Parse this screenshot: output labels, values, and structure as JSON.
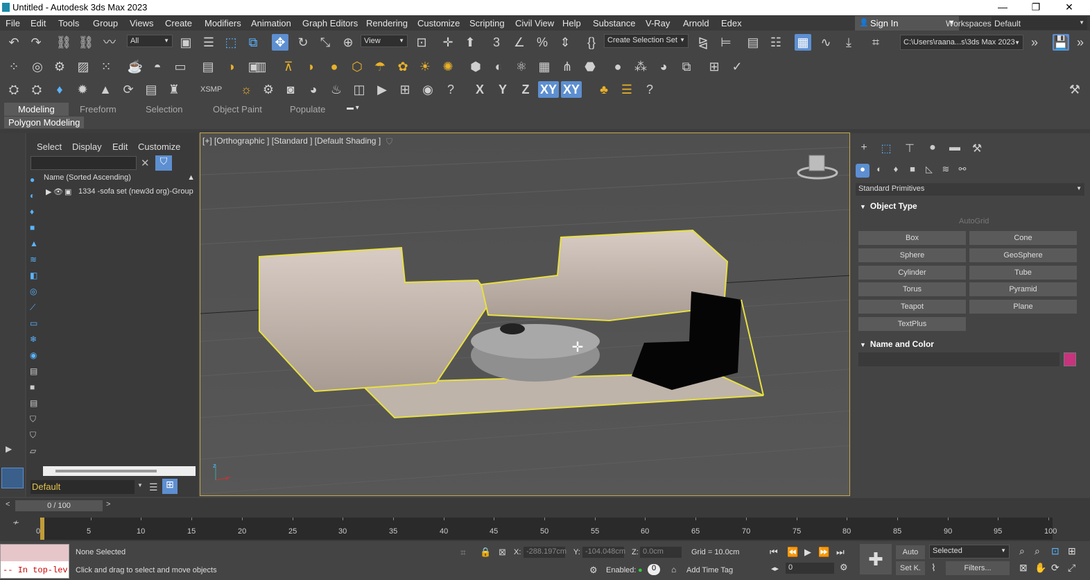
{
  "window": {
    "title": "Untitled - Autodesk 3ds Max 2023",
    "minimize": "—",
    "maximize": "❐",
    "close": "✕"
  },
  "menu": [
    "File",
    "Edit",
    "Tools",
    "Group",
    "Views",
    "Create",
    "Modifiers",
    "Animation",
    "Graph Editors",
    "Rendering",
    "Customize",
    "Scripting",
    "Civil View",
    "Help",
    "Substance",
    "V-Ray",
    "Arnold",
    "Edex"
  ],
  "signin": "Sign In",
  "workspaces": {
    "label": "Workspaces:",
    "value": "Default"
  },
  "toolbar": {
    "filter": "All",
    "refcoord": "View",
    "selset": "Create Selection Set",
    "path": "C:\\Users\\raana...s\\3ds Max 2023"
  },
  "toolbar3": {
    "xsmp": "XSMP",
    "x": "X",
    "y": "Y",
    "z": "Z",
    "xy": "XY",
    "xy2": "XY"
  },
  "ribbon": {
    "tabs": [
      "Modeling",
      "Freeform",
      "Selection",
      "Object Paint",
      "Populate"
    ],
    "sub": "Polygon Modeling"
  },
  "scene": {
    "menu": [
      "Select",
      "Display",
      "Edit",
      "Customize"
    ],
    "header": "Name (Sorted Ascending)",
    "item": "1334 -sofa set  (new3d org)-Group",
    "layer": "Default"
  },
  "viewport": {
    "label": "[+] [Orthographic ] [Standard ] [Default Shading ]"
  },
  "command": {
    "category": "Standard Primitives",
    "object_type": "Object Type",
    "autogrid": "AutoGrid",
    "buttons": [
      "Box",
      "Cone",
      "Sphere",
      "GeoSphere",
      "Cylinder",
      "Tube",
      "Torus",
      "Pyramid",
      "Teapot",
      "Plane",
      "TextPlus"
    ],
    "name_color": "Name and Color"
  },
  "time": {
    "frame": "0 / 100",
    "ticks": [
      "0",
      "5",
      "10",
      "15",
      "20",
      "25",
      "30",
      "35",
      "40",
      "45",
      "50",
      "55",
      "60",
      "65",
      "70",
      "75",
      "80",
      "85",
      "90",
      "95",
      "100"
    ]
  },
  "status": {
    "selected": "None Selected",
    "prompt": "Click and drag to select and move objects",
    "script": "-- In top-lev",
    "x_label": "X:",
    "x": "-288.197cm",
    "y_label": "Y:",
    "y": "-104.048cm",
    "z_label": "Z:",
    "z": "0.0cm",
    "grid": "Grid = 10.0cm",
    "enabled": "Enabled:",
    "timetag": "Add Time Tag",
    "auto": "Auto",
    "setk": "Set K.",
    "keymode": "Selected",
    "filters": "Filters...",
    "frame": "0",
    "zero": "0"
  }
}
